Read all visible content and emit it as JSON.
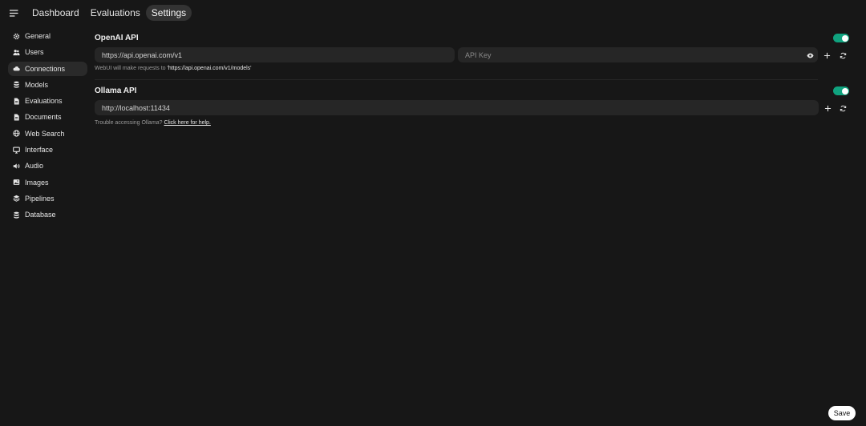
{
  "topnav": {
    "menu_icon": "menu-icon",
    "tabs": [
      {
        "label": "Dashboard",
        "active": false
      },
      {
        "label": "Evaluations",
        "active": false
      },
      {
        "label": "Settings",
        "active": true
      }
    ]
  },
  "sidebar": {
    "items": [
      {
        "label": "General",
        "icon": "gear-icon"
      },
      {
        "label": "Users",
        "icon": "users-icon"
      },
      {
        "label": "Connections",
        "icon": "cloud-icon",
        "active": true
      },
      {
        "label": "Models",
        "icon": "database-icon"
      },
      {
        "label": "Evaluations",
        "icon": "document-icon"
      },
      {
        "label": "Documents",
        "icon": "document-icon"
      },
      {
        "label": "Web Search",
        "icon": "globe-icon"
      },
      {
        "label": "Interface",
        "icon": "monitor-icon"
      },
      {
        "label": "Audio",
        "icon": "speaker-icon"
      },
      {
        "label": "Images",
        "icon": "image-icon"
      },
      {
        "label": "Pipelines",
        "icon": "layers-icon"
      },
      {
        "label": "Database",
        "icon": "database-icon"
      }
    ]
  },
  "openai": {
    "title": "OpenAI API",
    "enabled": true,
    "url_value": "https://api.openai.com/v1",
    "key_placeholder": "API Key",
    "hint_prefix": "WebUI will make requests to ",
    "hint_url": "'https://api.openai.com/v1/models'"
  },
  "ollama": {
    "title": "Ollama API",
    "enabled": true,
    "url_value": "http://localhost:11434",
    "hint_prefix": "Trouble accessing Ollama? ",
    "hint_link": "Click here for help."
  },
  "footer": {
    "save_label": "Save"
  },
  "colors": {
    "background": "#171717",
    "accent_toggle": "#10a37f",
    "field_bg": "#262626"
  }
}
